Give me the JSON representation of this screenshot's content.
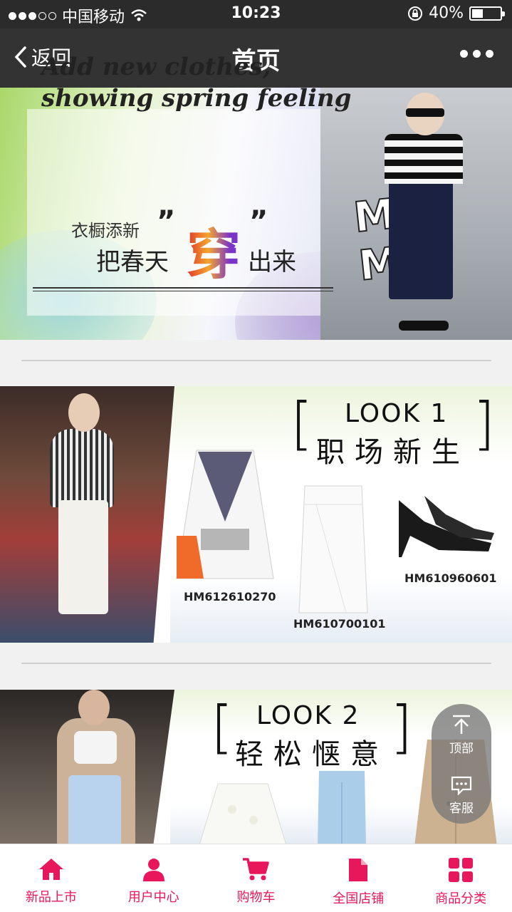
{
  "status_bar": {
    "carrier": "中国移动",
    "time": "10:23",
    "battery_percent": "40%",
    "battery_level": 0.4
  },
  "nav": {
    "back_label": "返回",
    "title": "首页",
    "more_icon": "more-dots-icon"
  },
  "banner": {
    "headline_line1": "Add new clothes,",
    "headline_line2": "showing spring feeling",
    "sub_small": "衣橱添新",
    "open_quote": "”",
    "big_char": "穿",
    "close_quote": "”",
    "sub_left": "把春天",
    "sub_right": "出来",
    "graffiti": "MK MO"
  },
  "looks": [
    {
      "title": "LOOK 1",
      "subtitle": "职场新生",
      "skus": [
        "HM612610270",
        "HM610700101",
        "HM610960601"
      ]
    },
    {
      "title": "LOOK 2",
      "subtitle": "轻松惬意",
      "skus": []
    }
  ],
  "float_buttons": {
    "top_label": "顶部",
    "service_label": "客服"
  },
  "tabbar": {
    "accent_color": "#e8165a",
    "items": [
      {
        "label": "新品上市",
        "icon": "home-icon"
      },
      {
        "label": "用户中心",
        "icon": "user-icon"
      },
      {
        "label": "购物车",
        "icon": "cart-icon"
      },
      {
        "label": "全国店铺",
        "icon": "document-icon"
      },
      {
        "label": "商品分类",
        "icon": "grid-icon"
      }
    ]
  }
}
